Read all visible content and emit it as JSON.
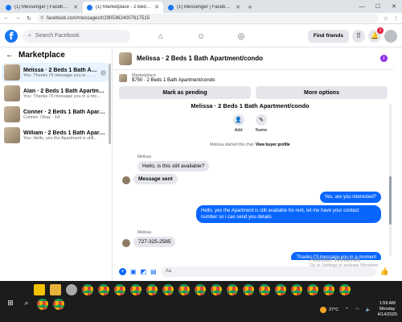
{
  "browser": {
    "tabs": [
      {
        "title": "(1) Messenger | Facebook",
        "active": false
      },
      {
        "title": "(1) Marketplace - 2 Beds 1 Bath",
        "active": true
      },
      {
        "title": "(1) Messenger | Facebook",
        "active": false
      }
    ],
    "url": "facebook.com/messages/t/29053624007617515"
  },
  "fbnav": {
    "search_placeholder": "Search Facebook",
    "find_friends": "Find friends",
    "notification_count": "1"
  },
  "sidebar": {
    "title": "Marketplace",
    "conversations": [
      {
        "name": "Melissa · 2 Beds 1 Bath Apartment/...",
        "preview": "You: Thanks i\"ll message you in ... · 1s"
      },
      {
        "name": "Alan · 2 Beds 1 Bath Apartment/...",
        "preview": "You: Thanks i\"ll message you in a mo..."
      },
      {
        "name": "Conner · 2 Beds 1 Bath Apartment/...",
        "preview": "Conner: Okay · 1d"
      },
      {
        "name": "William · 2 Beds 1 Bath Apartme...",
        "preview": "You: Hello, yes the Apartment is still..."
      }
    ]
  },
  "chat": {
    "header_title": "Melissa · 2 Beds 1 Bath Apartment/condo",
    "listing_label": "Marketplace",
    "listing_value": "$750 · 2 Beds 1 Bath Apartment/condo",
    "mark_pending": "Mark as pending",
    "more_options": "More options",
    "thread_title": "Melissa · 2 Beds 1 Bath Apartment/condo",
    "add_label": "Add",
    "name_label": "Name",
    "started_text": "Melissa started this chat.",
    "buyer_profile": "View buyer profile",
    "sender_name": "Melissa",
    "msg1": "Hello, is this still available?",
    "msg2": "Message sent",
    "out1": "Yes, are you interested?",
    "out2": "Hello, yes the Apartment is still available for rent, let me have your contact number so i can send you details",
    "sender_name2": "Melissa",
    "msg3": "727-325-2585",
    "out3": "Thanks i\"ll message you in a moment",
    "composer_value": "Aa"
  },
  "watermark": {
    "line1": "Activate Windows",
    "line2": "Go to Settings to activate Windows."
  },
  "taskbar": {
    "temperature": "27°C",
    "time": "1:59 AM",
    "day": "Monday",
    "date": "4/14/2025"
  }
}
